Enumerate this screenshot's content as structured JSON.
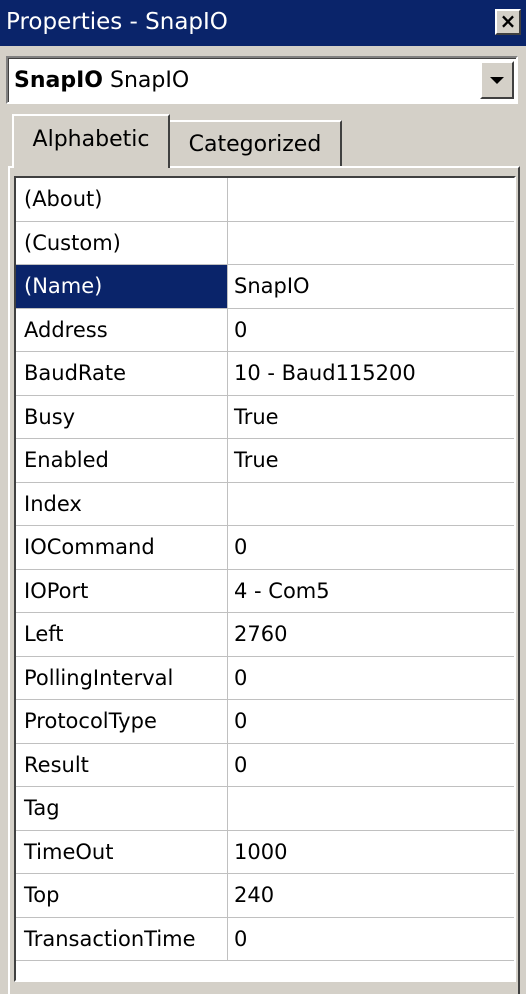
{
  "window": {
    "title": "Properties - SnapIO",
    "close_label": "×"
  },
  "object_selector": {
    "name": "SnapIO",
    "type": "SnapIO"
  },
  "tabs": [
    {
      "label": "Alphabetic",
      "active": true
    },
    {
      "label": "Categorized",
      "active": false
    }
  ],
  "properties": [
    {
      "name": "(About)",
      "value": ""
    },
    {
      "name": "(Custom)",
      "value": ""
    },
    {
      "name": "(Name)",
      "value": "SnapIO",
      "selected": true
    },
    {
      "name": "Address",
      "value": "0"
    },
    {
      "name": "BaudRate",
      "value": "10 - Baud115200"
    },
    {
      "name": "Busy",
      "value": "True"
    },
    {
      "name": "Enabled",
      "value": "True"
    },
    {
      "name": "Index",
      "value": ""
    },
    {
      "name": "IOCommand",
      "value": "0"
    },
    {
      "name": "IOPort",
      "value": "4 - Com5"
    },
    {
      "name": "Left",
      "value": "2760"
    },
    {
      "name": "PollingInterval",
      "value": "0"
    },
    {
      "name": "ProtocolType",
      "value": "0"
    },
    {
      "name": "Result",
      "value": "0"
    },
    {
      "name": "Tag",
      "value": ""
    },
    {
      "name": "TimeOut",
      "value": "1000"
    },
    {
      "name": "Top",
      "value": "240"
    },
    {
      "name": "TransactionTime",
      "value": "0"
    }
  ],
  "colors": {
    "titlebar": "#0a246a",
    "selection": "#0a246a",
    "face": "#d4d0c8"
  }
}
